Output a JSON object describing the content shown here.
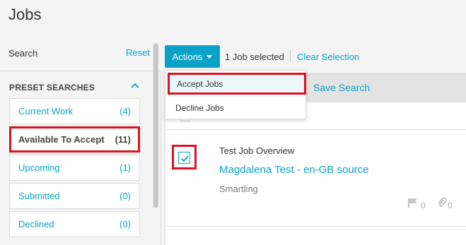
{
  "page": {
    "title": "Jobs"
  },
  "sidebar": {
    "search_label": "Search",
    "reset_label": "Reset",
    "preset_header": "PRESET SEARCHES",
    "items": [
      {
        "label": "Current Work",
        "count": "(4)"
      },
      {
        "label": "Available To Accept",
        "count": "(11)"
      },
      {
        "label": "Upcoming",
        "count": "(1)"
      },
      {
        "label": "Submitted",
        "count": "(0)"
      },
      {
        "label": "Declined",
        "count": "(0)"
      }
    ]
  },
  "toolbar": {
    "actions_label": "Actions",
    "selected_text": "1 Job selected",
    "clear_selection": "Clear Selection",
    "save_search": "Save Search"
  },
  "actions_menu": {
    "items": [
      "Accept Jobs",
      "Decline Jobs"
    ]
  },
  "jobs": [
    {
      "overview": "Test Job Overview",
      "title": "Magdalena Test - en-GB source",
      "client": "Smartling",
      "flag_count": "0",
      "attachment_count": "0",
      "selected": true
    }
  ],
  "colors": {
    "accent": "#0aa3c7",
    "highlight": "#e0101e"
  }
}
